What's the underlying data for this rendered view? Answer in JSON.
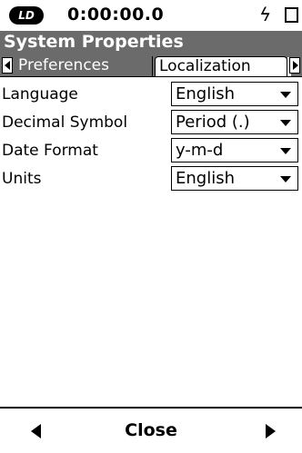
{
  "status": {
    "logo_text": "LD",
    "clock": "0:00:00.0",
    "power_icon": "lightning-bolt-icon",
    "battery_icon": "battery-icon"
  },
  "window": {
    "title": "System Properties"
  },
  "tabs": [
    {
      "label": "Preferences",
      "active": false
    },
    {
      "label": "Localization",
      "active": true
    }
  ],
  "settings": [
    {
      "label": "Language",
      "value": "English"
    },
    {
      "label": "Decimal Symbol",
      "value": "Period (.)"
    },
    {
      "label": "Date Format",
      "value": "y-m-d"
    },
    {
      "label": "Units",
      "value": "English"
    }
  ],
  "footer": {
    "close_label": "Close"
  },
  "colors": {
    "bar_gray": "#6b6b6b",
    "background": "#ffffff",
    "text": "#000000"
  }
}
